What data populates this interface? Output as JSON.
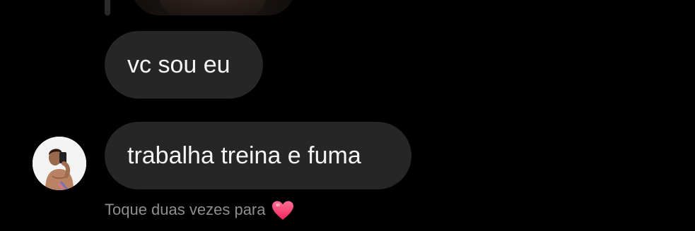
{
  "messages": [
    {
      "text": "vc sou eu"
    },
    {
      "text": "trabalha treina e fuma"
    }
  ],
  "hint": {
    "text": "Toque duas vezes para",
    "icon": "heart-icon"
  },
  "colors": {
    "background": "#000000",
    "bubble": "#262626",
    "bubble_text": "#f5f5f5",
    "hint_text": "#8e8e8e",
    "heart": "#ff3e74"
  }
}
